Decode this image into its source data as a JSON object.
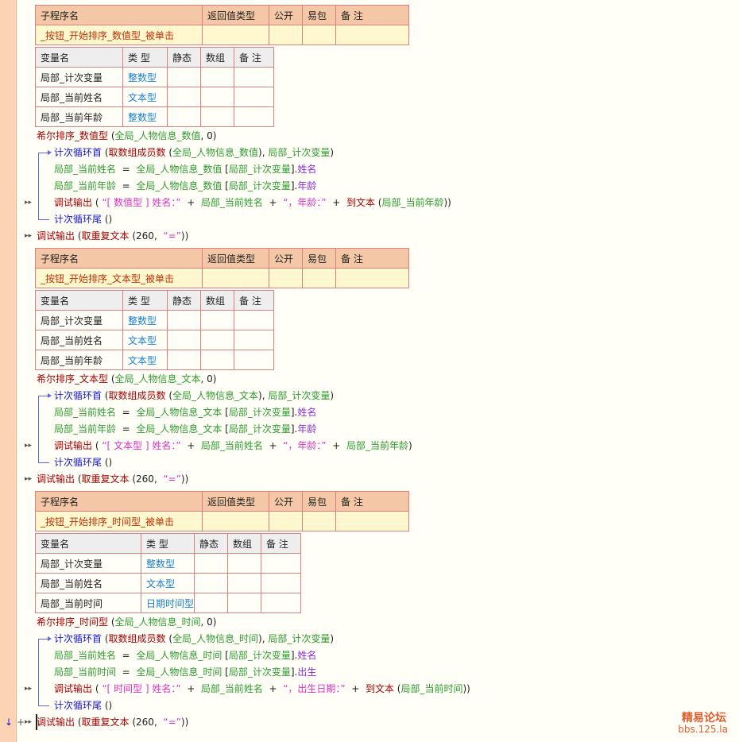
{
  "sub_header": {
    "name": "子程序名",
    "ret_type": "返回值类型",
    "public": "公开",
    "easy_pkg": "易包",
    "remark": "备 注"
  },
  "var_header": {
    "name": "变量名",
    "type": "类 型",
    "static": "静态",
    "array": "数组",
    "remark": "备 注"
  },
  "blocks": [
    {
      "sub_name": "_按钮_开始排序_数值型_被单击",
      "vars": [
        {
          "name": "局部_计次变量",
          "type": "整数型"
        },
        {
          "name": "局部_当前姓名",
          "type": "文本型"
        },
        {
          "name": "局部_当前年龄",
          "type": "整数型"
        }
      ],
      "code": {
        "sort_call": [
          "希尔排序_数值型",
          " (",
          "全局_人物信息_数值",
          ", 0)"
        ],
        "loop": [
          "计次循环首",
          " (",
          "取数组成员数",
          " (",
          "全局_人物信息_数值",
          "), ",
          "局部_计次变量",
          ")"
        ],
        "assign1": [
          "局部_当前姓名",
          "  =  ",
          "全局_人物信息_数值",
          " [",
          "局部_计次变量",
          "].",
          "姓名"
        ],
        "assign2": [
          "局部_当前年龄",
          "  =  ",
          "全局_人物信息_数值",
          " [",
          "局部_计次变量",
          "].",
          "年龄"
        ],
        "debug": [
          "调试输出",
          " ( ",
          "“[ 数值型 ] 姓名：”",
          "  +  ",
          "局部_当前姓名",
          "  +  ",
          "“，年龄：”",
          "  +  ",
          "到文本",
          " (",
          "局部_当前年龄",
          "))"
        ],
        "loop_end": [
          "计次循环尾",
          " ()"
        ],
        "final": [
          "调试输出",
          " (",
          "取重复文本",
          " (",
          "260",
          ",  ",
          "“=”",
          "))"
        ]
      }
    },
    {
      "sub_name": "_按钮_开始排序_文本型_被单击",
      "vars": [
        {
          "name": "局部_计次变量",
          "type": "整数型"
        },
        {
          "name": "局部_当前姓名",
          "type": "文本型"
        },
        {
          "name": "局部_当前年龄",
          "type": "文本型"
        }
      ],
      "code": {
        "sort_call": [
          "希尔排序_文本型",
          " (",
          "全局_人物信息_文本",
          ", 0)"
        ],
        "loop": [
          "计次循环首",
          " (",
          "取数组成员数",
          " (",
          "全局_人物信息_文本",
          "), ",
          "局部_计次变量",
          ")"
        ],
        "assign1": [
          "局部_当前姓名",
          "  =  ",
          "全局_人物信息_文本",
          " [",
          "局部_计次变量",
          "].",
          "姓名"
        ],
        "assign2": [
          "局部_当前年龄",
          "  =  ",
          "全局_人物信息_文本",
          " [",
          "局部_计次变量",
          "].",
          "年龄"
        ],
        "debug": [
          "调试输出",
          " ( ",
          "“[ 文本型 ] 姓名：”",
          "  +  ",
          "局部_当前姓名",
          "  +  ",
          "“，年龄：”",
          "  +  ",
          "",
          "",
          "局部_当前年龄",
          ")"
        ],
        "loop_end": [
          "计次循环尾",
          " ()"
        ],
        "final": [
          "调试输出",
          " (",
          "取重复文本",
          " (",
          "260",
          ",  ",
          "“=”",
          "))"
        ]
      }
    },
    {
      "sub_name": "_按钮_开始排序_时间型_被单击",
      "vars": [
        {
          "name": "局部_计次变量",
          "type": "整数型"
        },
        {
          "name": "局部_当前姓名",
          "type": "文本型"
        },
        {
          "name": "局部_当前时间",
          "type": "日期时间型"
        }
      ],
      "code": {
        "sort_call": [
          "希尔排序_时间型",
          " (",
          "全局_人物信息_时间",
          ", 0)"
        ],
        "loop": [
          "计次循环首",
          " (",
          "取数组成员数",
          " (",
          "全局_人物信息_时间",
          "), ",
          "局部_计次变量",
          ")"
        ],
        "assign1": [
          "局部_当前姓名",
          "  =  ",
          "全局_人物信息_时间",
          " [",
          "局部_计次变量",
          "].",
          "姓名"
        ],
        "assign2": [
          "局部_当前时间",
          "  =  ",
          "全局_人物信息_时间",
          " [",
          "局部_计次变量",
          "].",
          "出生"
        ],
        "debug": [
          "调试输出",
          " ( ",
          "“[ 时间型 ] 姓名：”",
          "  +  ",
          "局部_当前姓名",
          "  +  ",
          "“，出生日期：”",
          "  +  ",
          "到文本",
          " (",
          "局部_当前时间",
          "))"
        ],
        "loop_end": [
          "计次循环尾",
          " ()"
        ],
        "final": [
          "调试输出",
          " (",
          "取重复文本",
          " (",
          "260",
          ",  ",
          "“=”",
          "))"
        ]
      }
    }
  ],
  "marks": {
    "arrow": "▸▸",
    "down": "↓",
    "plus": "+"
  },
  "watermark": {
    "title": "精易论坛",
    "url": "bbs.125.la"
  },
  "colors": {
    "gutter": "#fcd4b4",
    "header": "#f4c8a6",
    "sub_row": "#fff8cf",
    "border": "#d98080",
    "keyword": "#1515c8",
    "type": "#1a7fd0"
  },
  "icons": [
    "loop-bracket-icon",
    "breakpoint-arrow-icon",
    "down-arrow-icon",
    "plus-icon"
  ]
}
